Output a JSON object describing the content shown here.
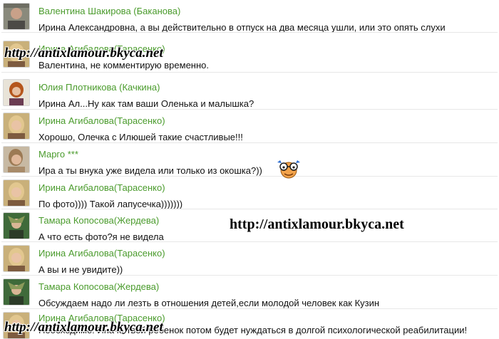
{
  "comments": [
    {
      "author": "Валентина Шакирова (Баканова)",
      "text": "Ирина Александровна, а вы действительно в отпуск на два месяца ушли, или это опять слухи"
    },
    {
      "author": "Ирина Агибалова(Тарасенко)",
      "text": "Валентина, не комментирую временно."
    },
    {
      "author": "Юлия Плотникова (Качкина)",
      "text": "Ирина Ал...Ну как там ваши Оленька и малышка?"
    },
    {
      "author": "Ирина Агибалова(Тарасенко)",
      "text": "Хорошо, Олечка с Илюшей такие счастливые!!!"
    },
    {
      "author": "Марго ***",
      "text": "Ира а ты внука уже видела или только из окошка?))"
    },
    {
      "author": "Ирина Агибалова(Тарасенко)",
      "text": "По фото)))) Такой лапусечка)))))))"
    },
    {
      "author": "Тамара Копосова(Жердева)",
      "text": "А что есть фото?я не видела"
    },
    {
      "author": "Ирина Агибалова(Тарасенко)",
      "text": "А вы и не увидите))"
    },
    {
      "author": "Тамара Копосова(Жердева)",
      "text": "Обсуждаем надо ли лезть в отношения детей,если молодой человек как Кузин"
    },
    {
      "author": "Ирина Агибалова(Тарасенко)",
      "text": "Необходимо! Иначе твой ребенок потом будет нуждаться в долгой психологической реабилитации!"
    }
  ],
  "watermarks": {
    "top": "http://antixlamour.bkyca.net",
    "middle": "http://antixlamour.bkyca.net",
    "bottom": "http://antixlamour.bkyca.net"
  },
  "colors": {
    "author": "#4a9b2c",
    "text": "#111111",
    "divider": "#e7e7e7"
  },
  "icons": [
    "user-avatar",
    "glasses-smiley-icon"
  ]
}
